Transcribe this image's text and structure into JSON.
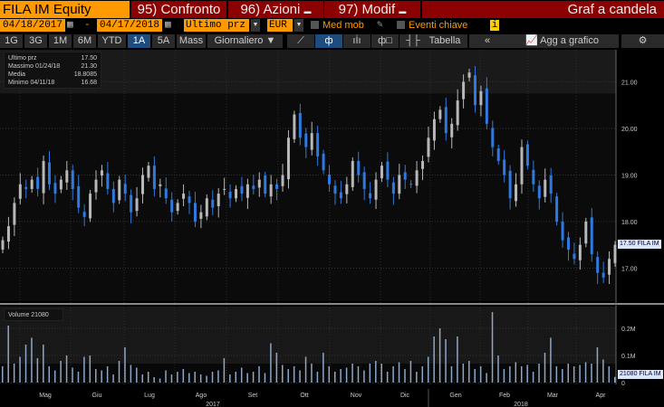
{
  "header": {
    "ticker": "FILA IM Equity",
    "btn1": "95) Confronto",
    "btn2": "96) Azioni",
    "btn3": "97) Modif",
    "title": "Graf a candela"
  },
  "range": {
    "start": "04/18/2017",
    "sep": "-",
    "end": "04/17/2018",
    "field": "Ultimo prz",
    "currency": "EUR",
    "med_mob": "Med mob",
    "eventi": "Eventi chiave",
    "info": "i"
  },
  "toolbar": {
    "periods": [
      "1G",
      "3G",
      "1M",
      "6M",
      "YTD",
      "1A",
      "5A",
      "Mass"
    ],
    "selected": "1A",
    "frequency": "Giornaliero ▼",
    "tabella": "Tabella",
    "collapse": "«",
    "add": "Agg a grafico"
  },
  "legend": {
    "rows": [
      {
        "label": "Ultimo prz",
        "value": "17.50"
      },
      {
        "label": "Massimo 01/24/18",
        "value": "21.30"
      },
      {
        "label": "Media",
        "value": "18.8085"
      },
      {
        "label": "Minimo 04/11/18",
        "value": "16.68"
      }
    ],
    "volume": "Volume 21080"
  },
  "colors": {
    "up": "#b8b8b8",
    "down": "#2f7ae0",
    "volume": "#8ea6c8",
    "header_orange": "#ff9900",
    "header_red": "#8b0000"
  },
  "chart_data": {
    "type": "candlestick",
    "x_range": [
      "04/18/2017",
      "04/17/2018"
    ],
    "y_range": [
      16.5,
      21.7
    ],
    "y_ticks": [
      "21.00",
      "20.00",
      "19.00",
      "18.00",
      "17.00"
    ],
    "y_tick_values": [
      21,
      20,
      19,
      18,
      17
    ],
    "last_price_tag": "17.50 FILA IM",
    "months": [
      "Mag",
      "Giu",
      "Lug",
      "Ago",
      "Set",
      "Ott",
      "Nov",
      "Dic",
      "Gen",
      "Feb",
      "Mar",
      "Apr"
    ],
    "years": [
      "2017",
      "2018"
    ],
    "closes": [
      17.6,
      17.9,
      18.4,
      18.8,
      18.7,
      18.9,
      18.7,
      19.3,
      18.8,
      18.6,
      18.9,
      19.1,
      18.7,
      18.3,
      18.1,
      18.6,
      18.9,
      19.1,
      18.7,
      18.4,
      18.9,
      18.6,
      18.2,
      18.5,
      19.0,
      19.2,
      18.7,
      18.8,
      18.5,
      18.2,
      18.4,
      18.6,
      18.4,
      18.0,
      18.2,
      18.5,
      18.3,
      18.6,
      18.7,
      18.5,
      18.7,
      18.6,
      18.8,
      18.7,
      18.9,
      18.6,
      18.8,
      18.7,
      19.0,
      19.8,
      20.3,
      19.8,
      19.6,
      19.9,
      19.4,
      19.1,
      18.8,
      18.6,
      18.5,
      18.8,
      19.3,
      19.0,
      18.7,
      18.5,
      18.9,
      19.2,
      18.9,
      18.6,
      19.0,
      18.9,
      18.8,
      19.1,
      19.3,
      19.8,
      20.2,
      20.4,
      19.9,
      20.1,
      20.6,
      21.0,
      21.2,
      20.5,
      20.8,
      20.1,
      19.6,
      19.3,
      19.0,
      18.5,
      18.8,
      19.6,
      19.2,
      18.8,
      18.5,
      18.9,
      18.6,
      18.0,
      17.6,
      17.4,
      17.2,
      17.5,
      18.0,
      17.3,
      16.9,
      16.8,
      17.2,
      17.5
    ],
    "volume": {
      "y_ticks": [
        "0.2M",
        "0.1M",
        "0"
      ],
      "y_tick_values": [
        200000,
        100000,
        0
      ],
      "last_tag": "21080 FILA IM",
      "values_k": [
        60,
        210,
        70,
        95,
        140,
        165,
        90,
        140,
        60,
        45,
        80,
        100,
        55,
        40,
        95,
        100,
        50,
        45,
        60,
        30,
        80,
        130,
        65,
        55,
        30,
        40,
        20,
        15,
        45,
        30,
        40,
        50,
        35,
        40,
        30,
        25,
        40,
        45,
        90,
        30,
        40,
        55,
        35,
        40,
        60,
        35,
        145,
        110,
        65,
        50,
        60,
        45,
        95,
        70,
        40,
        110,
        60,
        40,
        50,
        55,
        70,
        60,
        45,
        70,
        80,
        70,
        40,
        60,
        75,
        50,
        80,
        40,
        60,
        95,
        170,
        200,
        160,
        60,
        170,
        70,
        80,
        50,
        60,
        35,
        260,
        100,
        50,
        60,
        75,
        60,
        65,
        40,
        70,
        110,
        165,
        60,
        50,
        70,
        60,
        65,
        75,
        70,
        130,
        85,
        60,
        21
      ]
    }
  }
}
